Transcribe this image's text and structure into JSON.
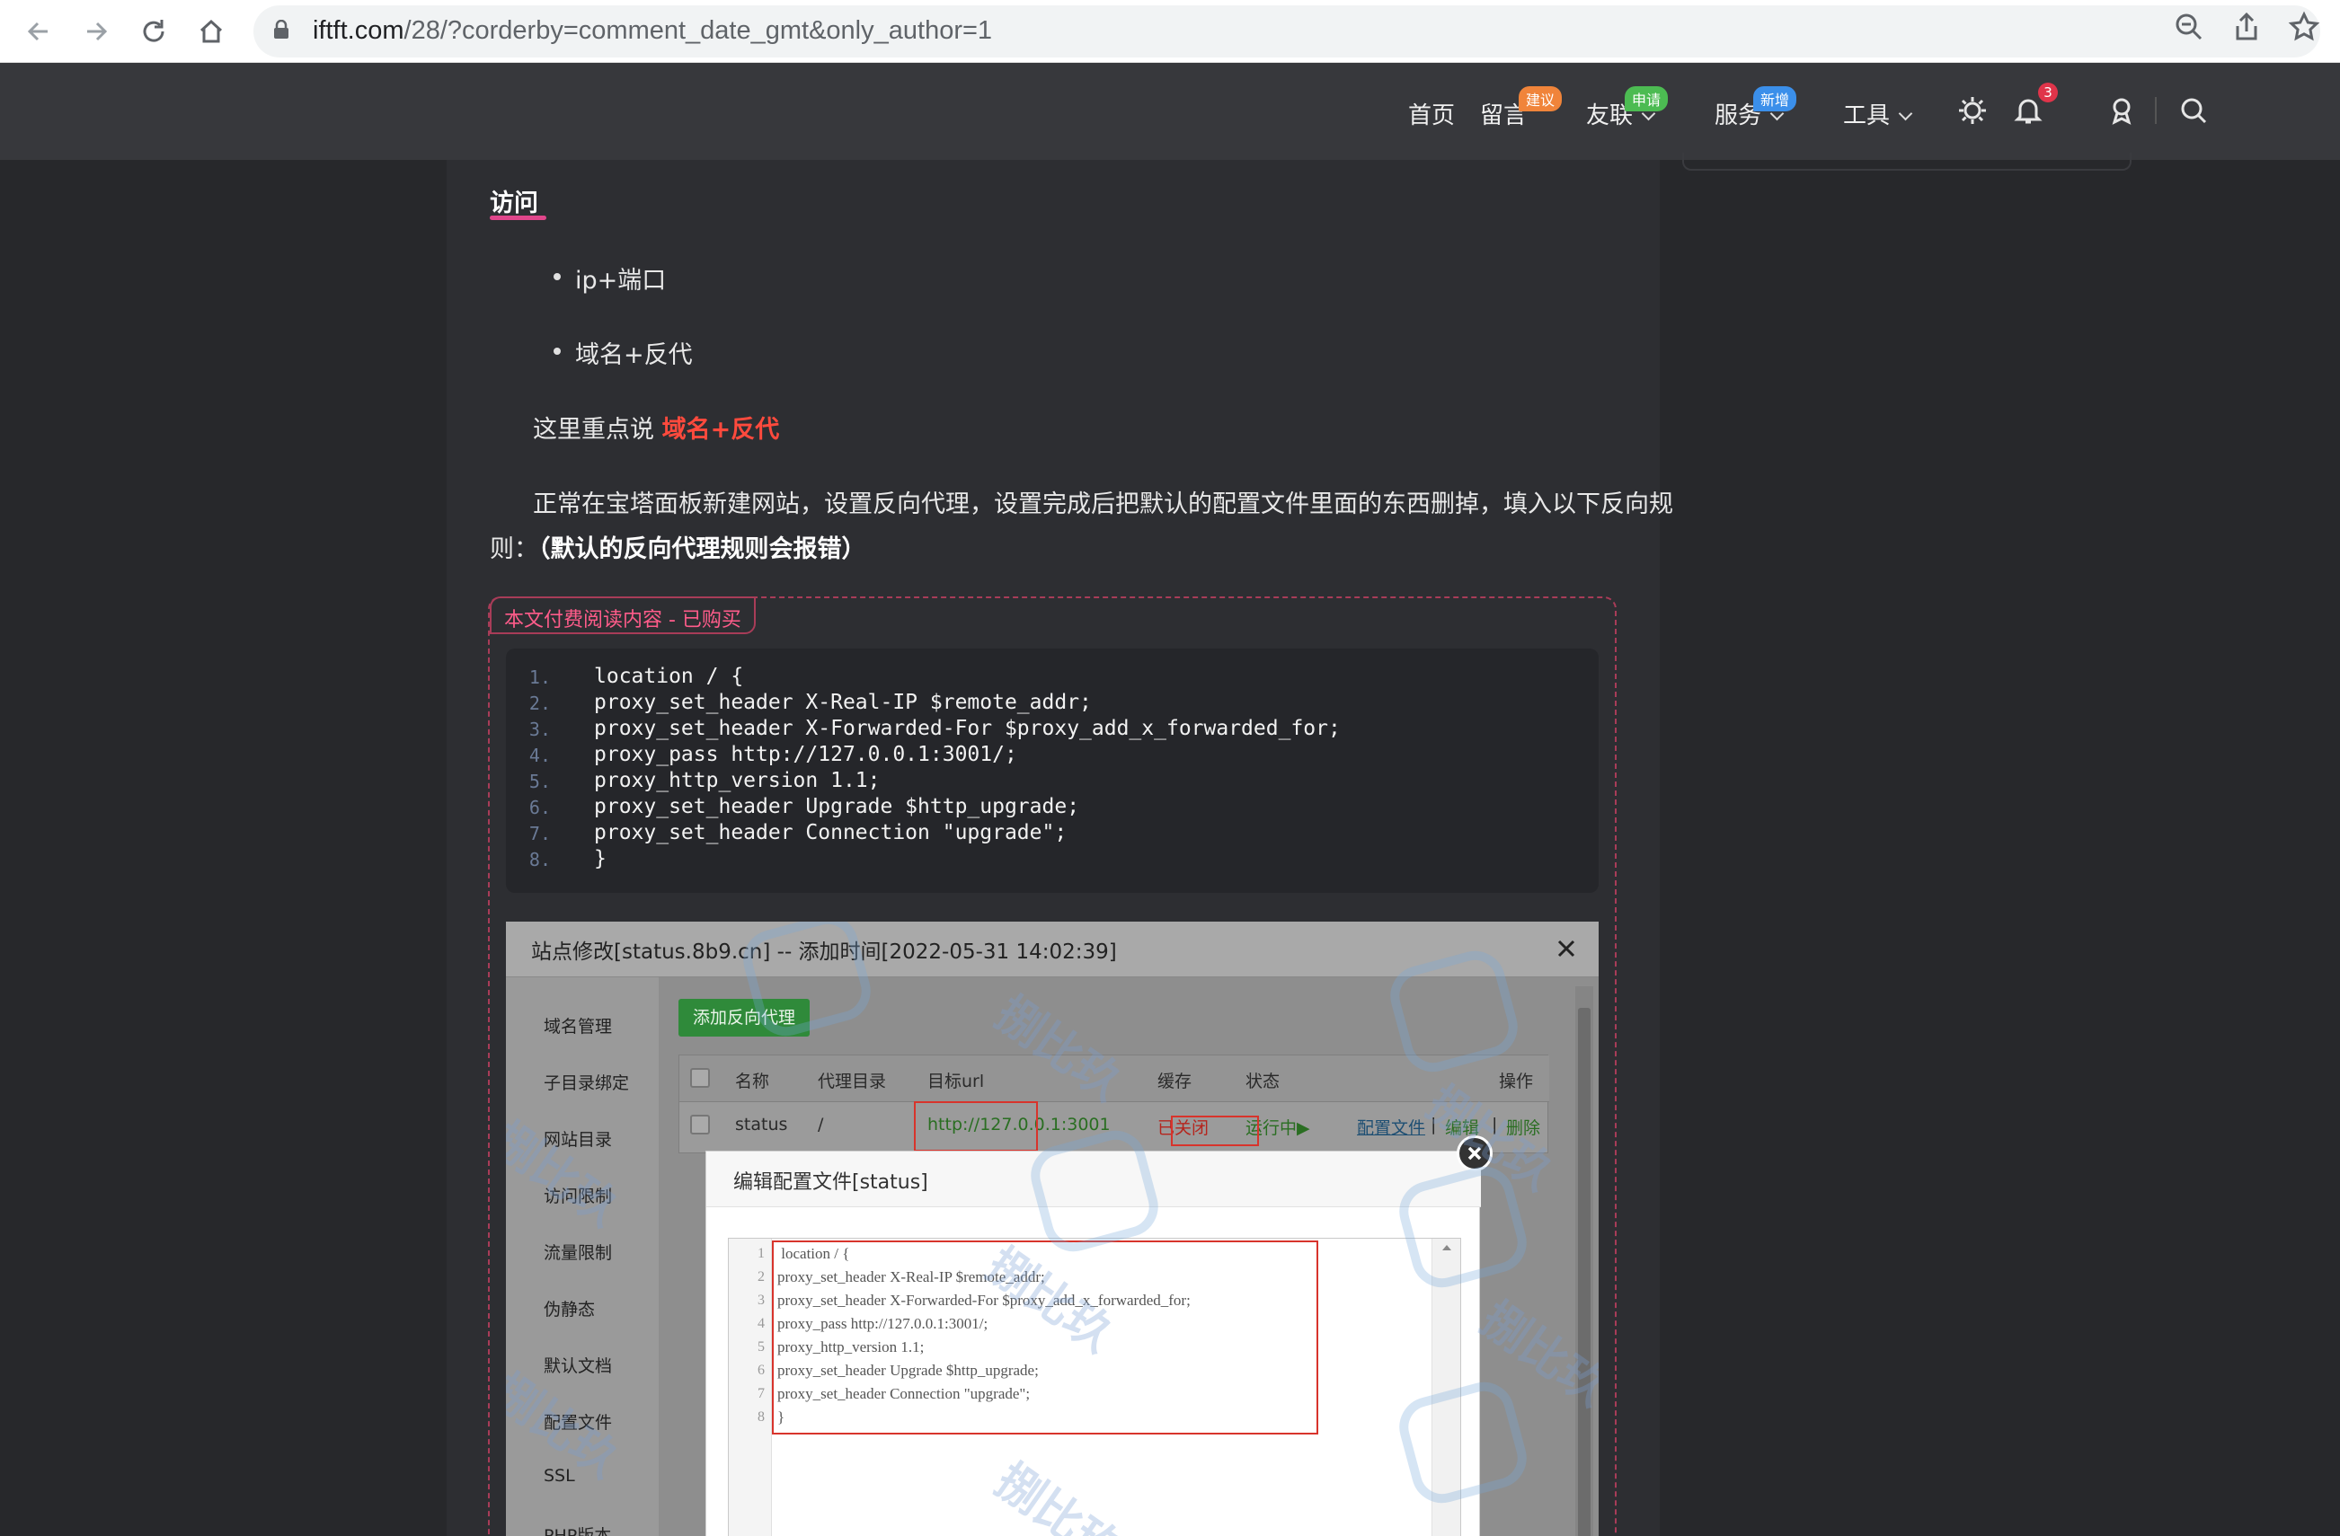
{
  "browser": {
    "url_host": "iftft.com",
    "url_path": "/28/?corderby=comment_date_gmt&only_author=1"
  },
  "header": {
    "menu": [
      {
        "label": "首页"
      },
      {
        "label": "留言",
        "badge": "建议",
        "badge_color": "#f0843a"
      },
      {
        "label": "友联",
        "badge": "申请",
        "badge_color": "#4cbb52"
      },
      {
        "label": "服务",
        "badge": "新增",
        "badge_color": "#3b8fea"
      },
      {
        "label": "工具"
      }
    ],
    "notification_count": "3"
  },
  "article": {
    "section_title": "访问",
    "bullets": [
      "ip+端口",
      "域名+反代"
    ],
    "para1_prefix": "这里重点说 ",
    "para1_highlight": "域名+反代",
    "para2_line1": "正常在宝塔面板新建网站，设置反向代理，设置完成后把默认的配置文件里面的东西删掉，填入以下反向规",
    "para2_line2_prefix": "则：",
    "para2_line2_bold": "（默认的反向代理规则会报错）",
    "paid_tag": "本文付费阅读内容 - 已购买",
    "code_lines": [
      "location / {",
      "proxy_set_header X-Real-IP $remote_addr;",
      "proxy_set_header X-Forwarded-For $proxy_add_x_forwarded_for;",
      "proxy_pass http://127.0.0.1:3001/;",
      "proxy_http_version 1.1;",
      "proxy_set_header Upgrade $http_upgrade;",
      "proxy_set_header Connection \"upgrade\";",
      "}"
    ],
    "line_numbers": [
      "1.",
      "2.",
      "3.",
      "4.",
      "5.",
      "6.",
      "7.",
      "8."
    ]
  },
  "screenshot": {
    "title": "站点修改[status.8b9.cn] -- 添加时间[2022-05-31 14:02:39]",
    "side_items": [
      "域名管理",
      "子目录绑定",
      "网站目录",
      "访问限制",
      "流量限制",
      "伪静态",
      "默认文档",
      "配置文件",
      "SSL",
      "PHP版本"
    ],
    "add_button": "添加反向代理",
    "table_headers": {
      "name": "名称",
      "dir": "代理目录",
      "url": "目标url",
      "cache": "缓存",
      "status": "状态",
      "ops": "操作"
    },
    "row": {
      "name": "status",
      "dir": "/",
      "url": "http://127.0.0.1:3001",
      "cache": "已关闭",
      "status": "运行中▶",
      "op_config": "配置文件",
      "sep1": "|",
      "op_edit": "编辑",
      "sep2": "|",
      "op_delete": "删除"
    },
    "modal_title": "编辑配置文件[status]",
    "editor_lines": [
      " location / {",
      "proxy_set_header X-Real-IP $remote_addr;",
      "proxy_set_header X-Forwarded-For $proxy_add_x_forwarded_for;",
      "proxy_pass http://127.0.0.1:3001/;",
      "proxy_http_version 1.1;",
      "proxy_set_header Upgrade $http_upgrade;",
      "proxy_set_header Connection \"upgrade\";",
      "}"
    ],
    "editor_line_numbers": [
      "1",
      "2",
      "3",
      "4",
      "5",
      "6",
      "7",
      "8"
    ],
    "watermark": "捌比玖"
  }
}
